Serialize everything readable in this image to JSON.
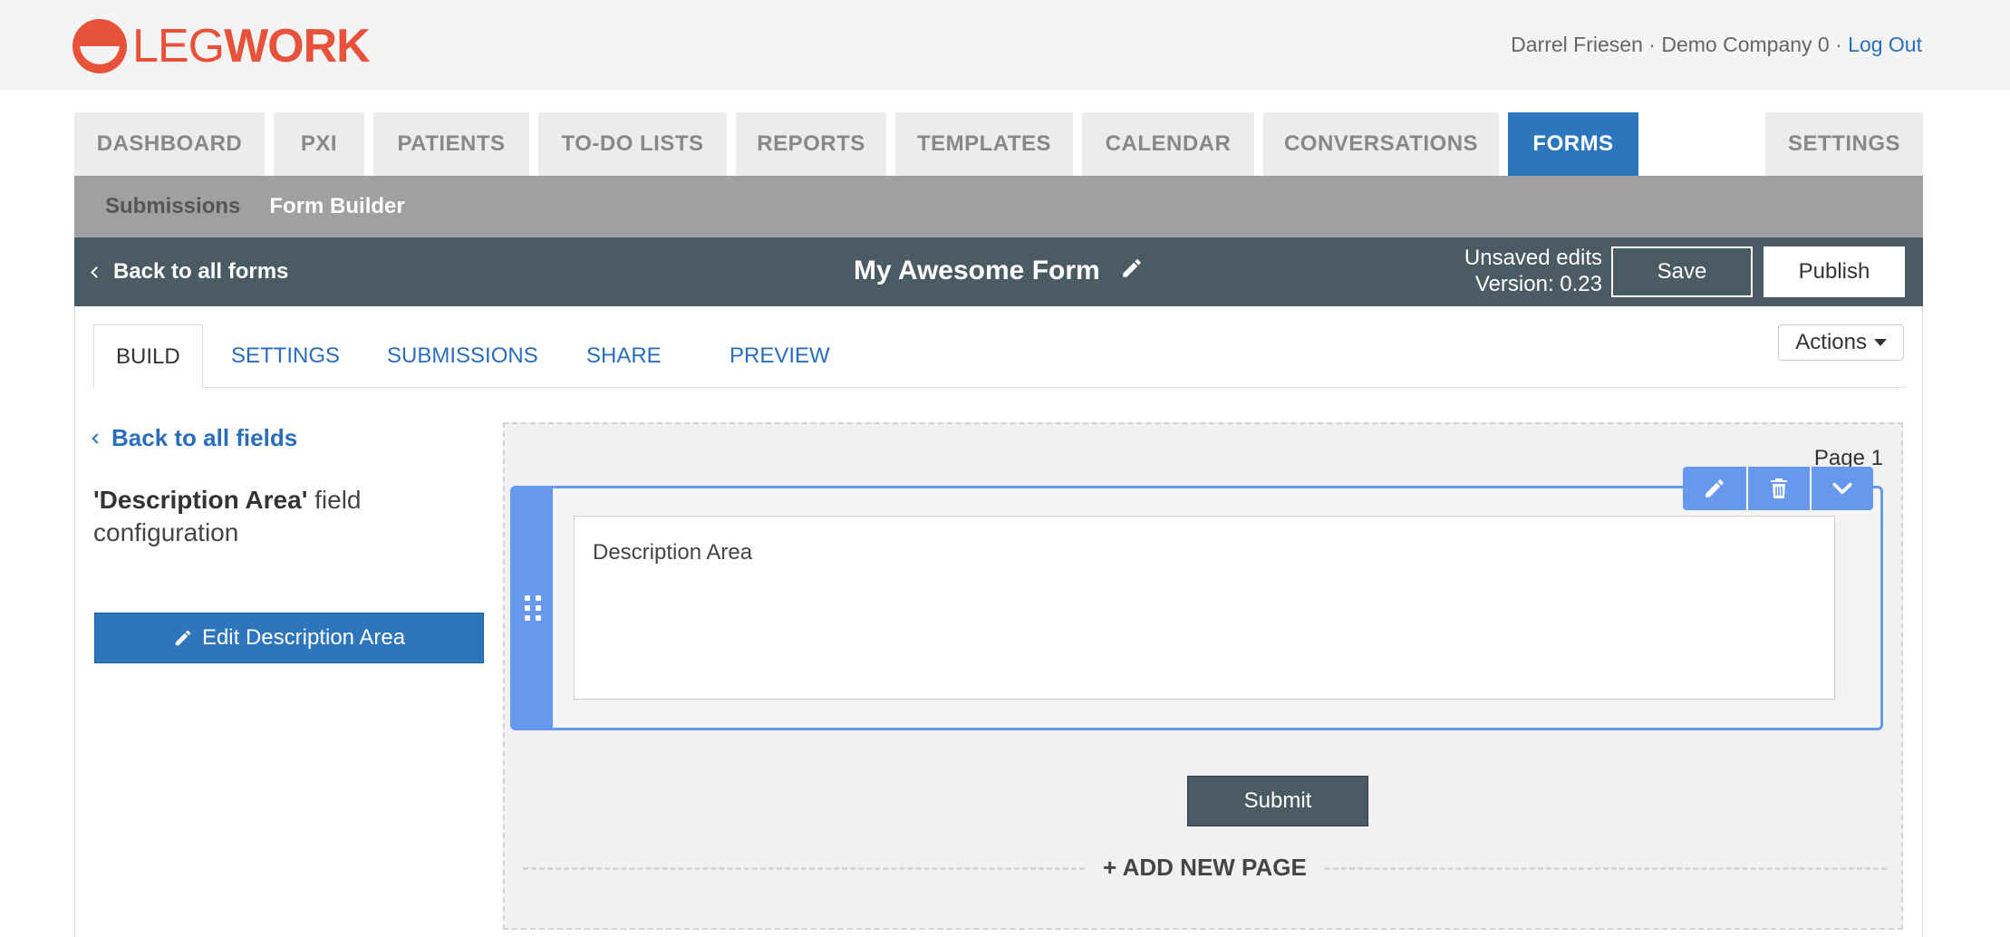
{
  "app": {
    "logo_text_thin": "LEG",
    "logo_text_bold": "WORK",
    "brand_color": "#e8513a",
    "accent_color": "#2d76bd"
  },
  "user": {
    "name": "Darrel Friesen",
    "company": "Demo Company 0",
    "separator": "·",
    "logout_label": "Log Out"
  },
  "main_nav": {
    "tabs": [
      {
        "label": "DASHBOARD"
      },
      {
        "label": "PXI"
      },
      {
        "label": "PATIENTS"
      },
      {
        "label": "TO-DO LISTS"
      },
      {
        "label": "REPORTS"
      },
      {
        "label": "TEMPLATES"
      },
      {
        "label": "CALENDAR"
      },
      {
        "label": "CONVERSATIONS"
      },
      {
        "label": "FORMS",
        "active": true
      },
      {
        "label": "SETTINGS"
      }
    ]
  },
  "sub_nav": {
    "items": [
      {
        "label": "Submissions"
      },
      {
        "label": "Form Builder",
        "active": true
      }
    ]
  },
  "form_header": {
    "back_label": "Back to all forms",
    "title": "My Awesome Form",
    "status_line1": "Unsaved edits",
    "status_line2": "Version: 0.23",
    "save_label": "Save",
    "publish_label": "Publish"
  },
  "builder_tabs": {
    "tabs": [
      {
        "label": "BUILD",
        "active": true
      },
      {
        "label": "SETTINGS"
      },
      {
        "label": "SUBMISSIONS"
      },
      {
        "label": "SHARE"
      },
      {
        "label": "PREVIEW"
      }
    ],
    "actions_label": "Actions"
  },
  "left_panel": {
    "back_label": "Back to all fields",
    "field_name": "'Description Area'",
    "config_suffix": " field configuration",
    "edit_button_label": "Edit Description Area"
  },
  "canvas": {
    "page_label": "Page 1",
    "field_text": "Description Area",
    "toolbar_icons": [
      "pencil-icon",
      "trash-icon",
      "chevron-down-icon"
    ],
    "submit_label": "Submit",
    "add_page_label": "+ ADD NEW PAGE"
  }
}
